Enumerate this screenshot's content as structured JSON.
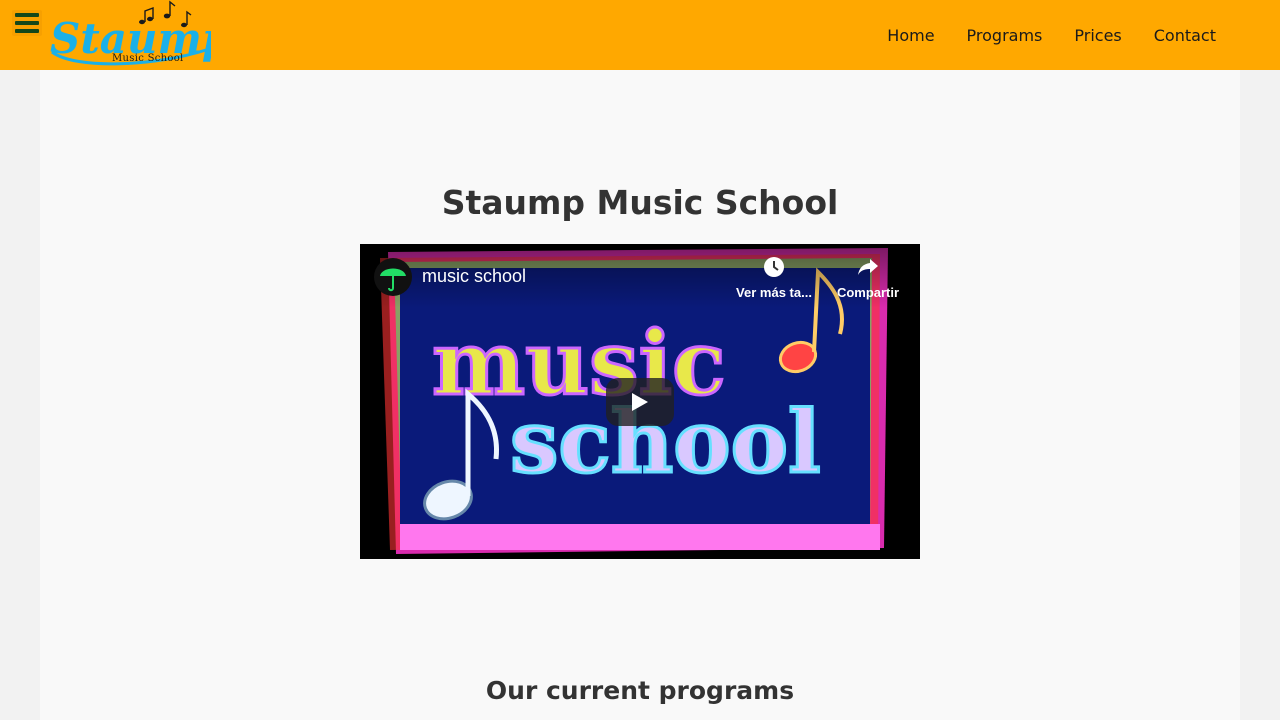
{
  "header": {
    "logo_text": "Staump",
    "logo_tagline": "Music School",
    "nav": [
      {
        "label": "Home"
      },
      {
        "label": "Programs"
      },
      {
        "label": "Prices"
      },
      {
        "label": "Contact"
      }
    ]
  },
  "main": {
    "title": "Staump Music School",
    "video": {
      "title": "music school",
      "watch_later_label": "Ver más ta...",
      "share_label": "Compartir",
      "thumbnail_text_1": "music",
      "thumbnail_text_2": "school"
    },
    "section_title": "Our current programs"
  },
  "colors": {
    "header_bg": "#ffa800",
    "logo_blue": "#1ab0e8",
    "menu_icon": "#14471a",
    "video_bg": "#0a1a7a"
  }
}
